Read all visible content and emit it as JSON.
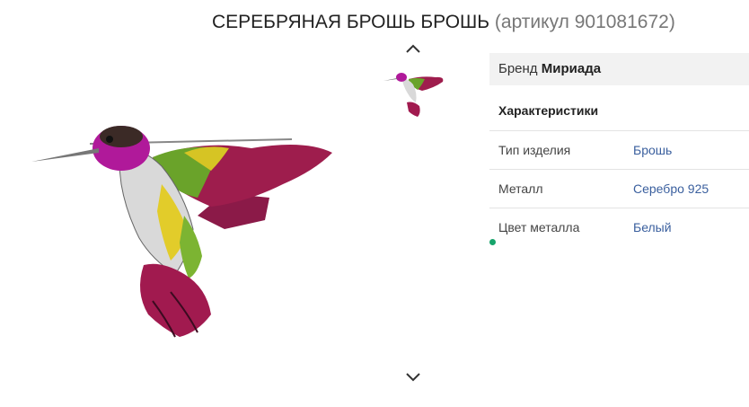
{
  "product": {
    "title": "СЕРЕБРЯНАЯ БРОШЬ БРОШЬ",
    "sku": "(артикул 901081672)"
  },
  "gallery": {
    "up_icon": "chevron-up-icon",
    "down_icon": "chevron-down-icon",
    "main_image": "hummingbird-brooch",
    "thumbnail": "hummingbird-brooch"
  },
  "brand": {
    "label": "Бренд",
    "value": "Мириада"
  },
  "characteristics": {
    "heading": "Характеристики",
    "rows": [
      {
        "label": "Тип изделия",
        "value": "Брошь"
      },
      {
        "label": "Металл",
        "value": "Серебро 925"
      },
      {
        "label": "Цвет металла",
        "value": "Белый"
      }
    ]
  },
  "colors": {
    "link": "#3a5f9e",
    "brand_bg": "#f2f2f2",
    "status_dot": "#17a46b"
  }
}
